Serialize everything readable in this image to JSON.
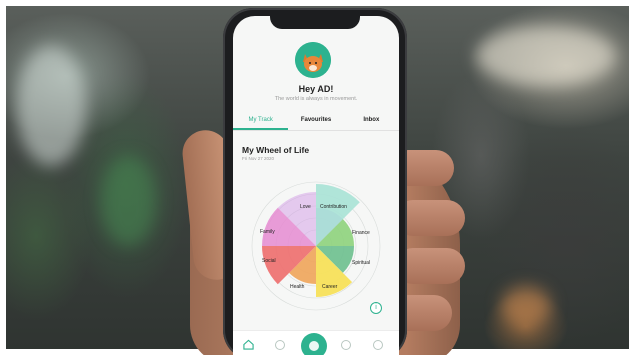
{
  "app": {
    "greeting": "Hey AD!",
    "subtitle": "The world is always in movement.",
    "tabs": [
      {
        "label": "My Track",
        "active": true
      },
      {
        "label": "Favourites",
        "active": false
      },
      {
        "label": "Inbox",
        "active": false
      }
    ],
    "card": {
      "title": "My Wheel of Life",
      "date": "Fri Nov 27 2020"
    },
    "wheel_labels": [
      "Love",
      "Contribution",
      "Finance",
      "Spiritual",
      "Career",
      "Health",
      "Social",
      "Family"
    ],
    "info_glyph": "i",
    "nav_icons": [
      "home-icon",
      "compass-icon",
      "add-icon",
      "settings-icon",
      "profile-icon"
    ],
    "accent_color": "#2db28f"
  }
}
